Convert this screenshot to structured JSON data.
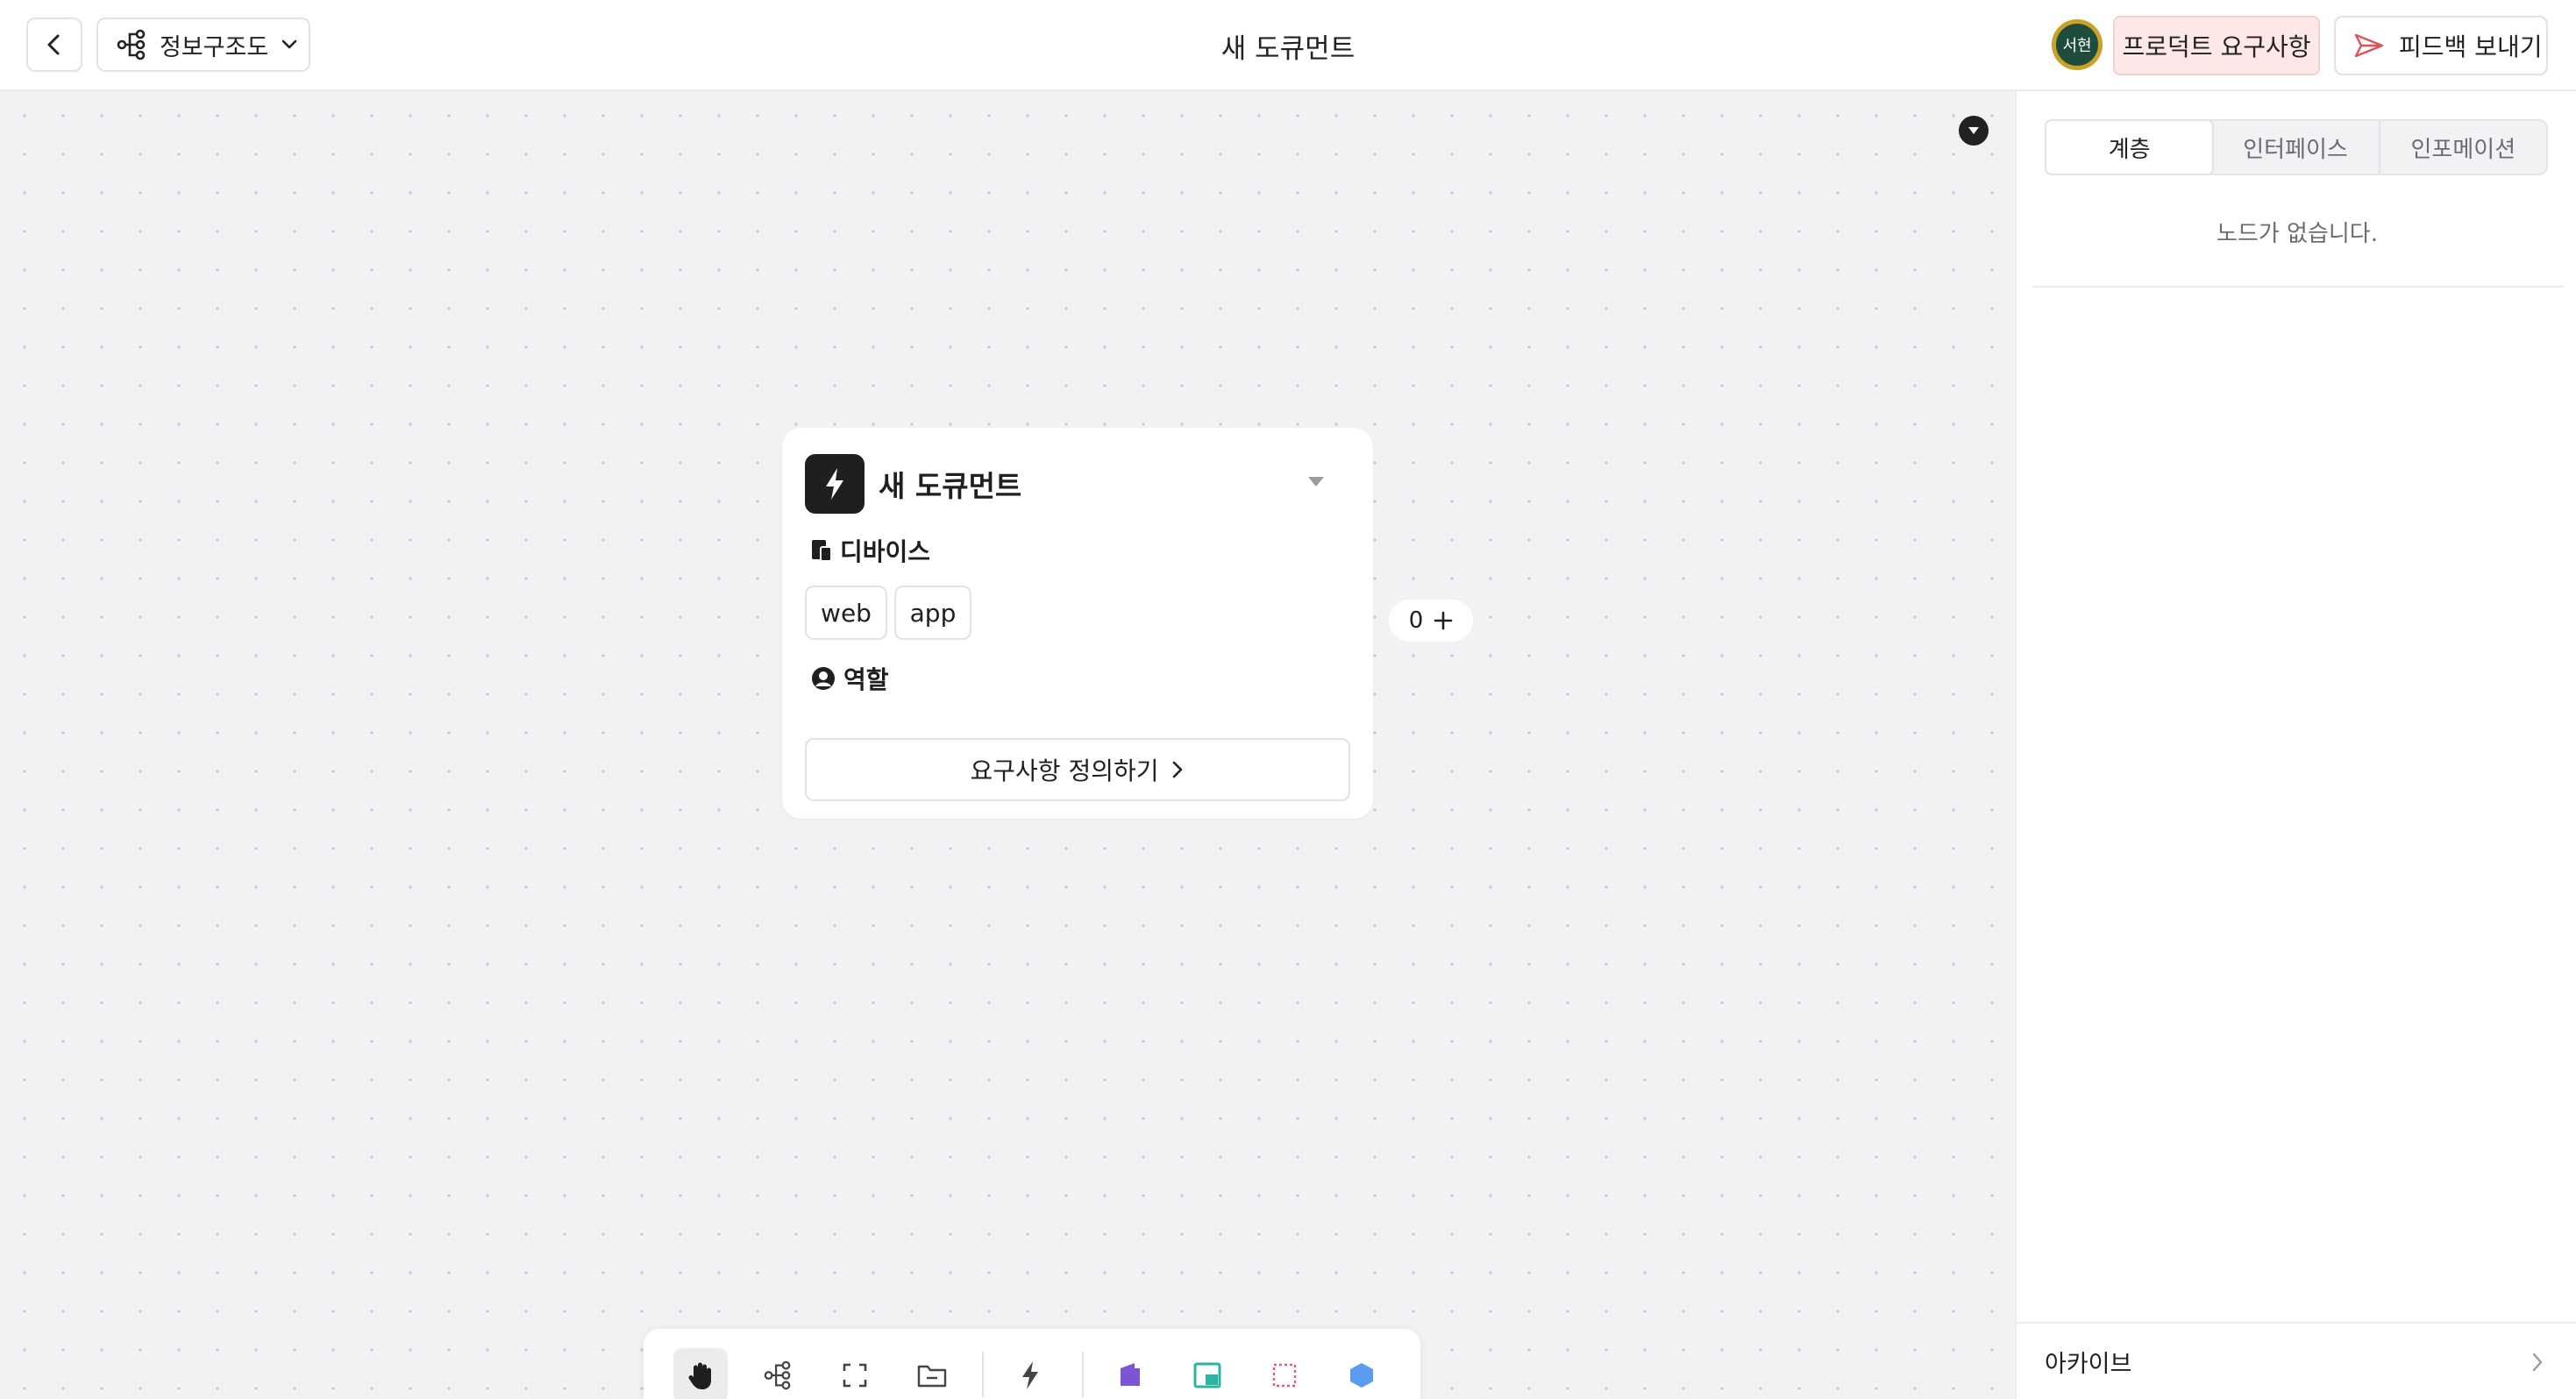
{
  "header": {
    "view_selector": "정보구조도",
    "title": "새 도큐먼트",
    "avatar_text": "서현",
    "product_requirements_label": "프로덕트 요구사항",
    "feedback_label": "피드백 보내기"
  },
  "node": {
    "title": "새 도큐먼트",
    "device_label": "디바이스",
    "devices": [
      "web",
      "app"
    ],
    "role_label": "역할",
    "define_button_label": "요구사항 정의하기",
    "connection_count": "0"
  },
  "toolbar": {
    "tools": [
      "hand-icon",
      "tree-icon",
      "frame-icon",
      "folder-icon",
      "bolt-icon",
      "device-icon",
      "screen-icon",
      "section-icon",
      "component-icon"
    ],
    "active_tool": "hand-icon"
  },
  "panel": {
    "tabs": [
      "계층",
      "인터페이스",
      "인포메이션"
    ],
    "active_tab": "계층",
    "empty_message": "노드가 없습니다.",
    "archive_label": "아카이브"
  },
  "colors": {
    "accent_pink": "#fde7e7",
    "canvas_bg": "#f2f2f4",
    "device_purple": "#7b55d3",
    "screen_teal": "#2bb3a3",
    "section_pink": "#e25b8a",
    "component_blue": "#5b9bf2"
  }
}
